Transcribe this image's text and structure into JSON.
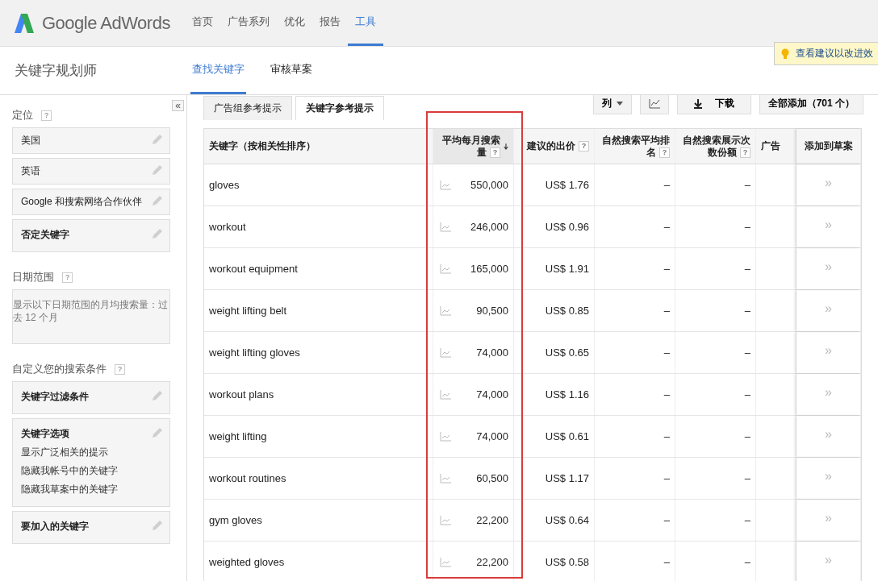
{
  "header": {
    "logo": "Google AdWords",
    "nav": [
      {
        "label": "首页",
        "selected": false
      },
      {
        "label": "广告系列",
        "selected": false
      },
      {
        "label": "优化",
        "selected": false
      },
      {
        "label": "报告",
        "selected": false
      },
      {
        "label": "工具",
        "selected": true
      }
    ]
  },
  "subheader": {
    "title": "关键字规划师",
    "tabs": [
      {
        "label": "查找关键字",
        "selected": true
      },
      {
        "label": "审核草案",
        "selected": false
      }
    ],
    "tip": "查看建议以改进效"
  },
  "sidebar": {
    "collapse": "«",
    "sections": [
      {
        "heading": "定位",
        "help": "?",
        "items": [
          {
            "kind": "value",
            "text": "美国"
          },
          {
            "kind": "value",
            "text": "英语"
          },
          {
            "kind": "value",
            "text": "Google 和搜索网络合作伙伴"
          },
          {
            "kind": "title",
            "text": "否定关键字"
          }
        ]
      },
      {
        "heading": "日期范围",
        "help": "?",
        "items": [
          {
            "kind": "note",
            "text": "显示以下日期范围的月均搜索量：过去 12 个月"
          }
        ]
      },
      {
        "heading": "自定义您的搜索条件",
        "help": "?",
        "items": [
          {
            "kind": "title",
            "text": "关键字过滤条件"
          },
          {
            "kind": "title",
            "text": "关键字选项",
            "lines": [
              "显示广泛相关的提示",
              "隐藏我帐号中的关键字",
              "隐藏我草案中的关键字"
            ]
          },
          {
            "kind": "title",
            "text": "要加入的关键字"
          }
        ]
      }
    ]
  },
  "tabs": [
    {
      "label": "广告组参考提示",
      "selected": false
    },
    {
      "label": "关键字参考提示",
      "selected": true
    }
  ],
  "toolbar": {
    "columns": "列",
    "download": "下载",
    "add_all": "全部添加（701 个）"
  },
  "table": {
    "columns": [
      {
        "label": "关键字（按相关性排序）"
      },
      {
        "label": "平均每月搜索量",
        "help": "?",
        "sorted": true
      },
      {
        "label": "建议的出价",
        "help": "?"
      },
      {
        "label": "自然搜索平均排名",
        "help": "?"
      },
      {
        "label": "自然搜索展示次数份额",
        "help": "?"
      },
      {
        "label": "广告"
      },
      {
        "label": "添加到草案"
      }
    ],
    "rows": [
      {
        "keyword": "gloves",
        "volume": "550,000",
        "bid": "US$ 1.76",
        "rank": "–",
        "share": "–",
        "add": "»"
      },
      {
        "keyword": "workout",
        "volume": "246,000",
        "bid": "US$ 0.96",
        "rank": "–",
        "share": "–",
        "add": "»"
      },
      {
        "keyword": "workout equipment",
        "volume": "165,000",
        "bid": "US$ 1.91",
        "rank": "–",
        "share": "–",
        "add": "»"
      },
      {
        "keyword": "weight lifting belt",
        "volume": "90,500",
        "bid": "US$ 0.85",
        "rank": "–",
        "share": "–",
        "add": "»"
      },
      {
        "keyword": "weight lifting gloves",
        "volume": "74,000",
        "bid": "US$ 0.65",
        "rank": "–",
        "share": "–",
        "add": "»"
      },
      {
        "keyword": "workout plans",
        "volume": "74,000",
        "bid": "US$ 1.16",
        "rank": "–",
        "share": "–",
        "add": "»"
      },
      {
        "keyword": "weight lifting",
        "volume": "74,000",
        "bid": "US$ 0.61",
        "rank": "–",
        "share": "–",
        "add": "»"
      },
      {
        "keyword": "workout routines",
        "volume": "60,500",
        "bid": "US$ 1.17",
        "rank": "–",
        "share": "–",
        "add": "»"
      },
      {
        "keyword": "gym gloves",
        "volume": "22,200",
        "bid": "US$ 0.64",
        "rank": "–",
        "share": "–",
        "add": "»"
      },
      {
        "keyword": "weighted gloves",
        "volume": "22,200",
        "bid": "US$ 0.58",
        "rank": "–",
        "share": "–",
        "add": "»"
      }
    ]
  }
}
